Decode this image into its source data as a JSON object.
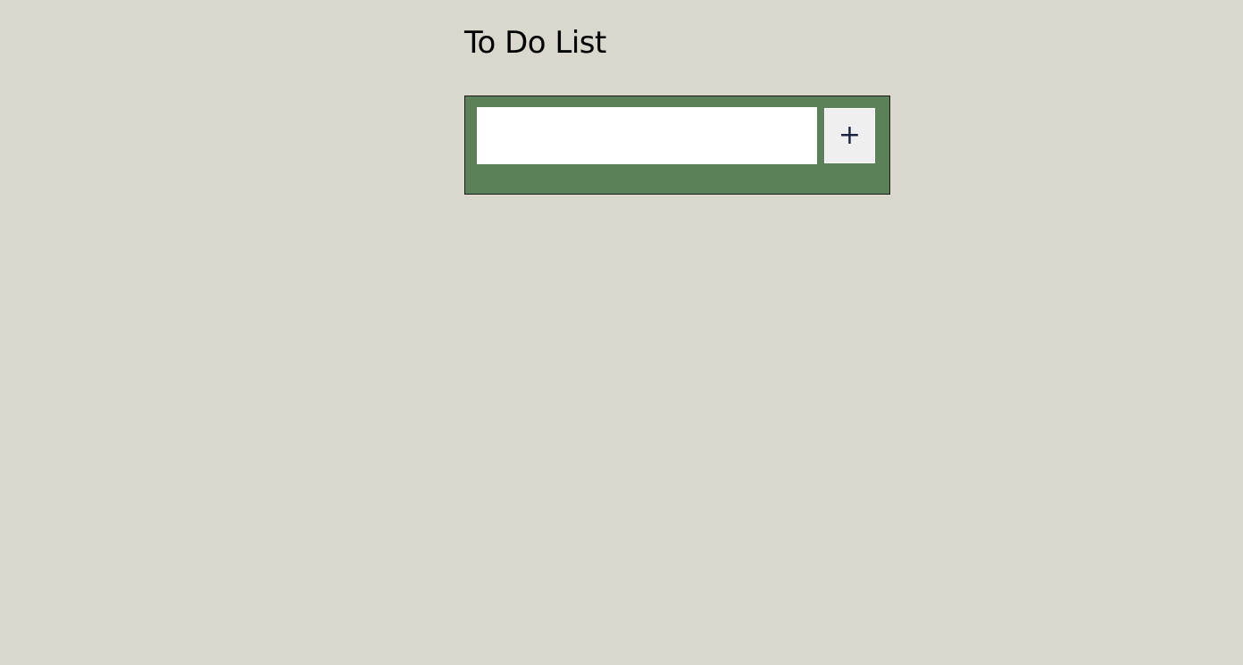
{
  "header": {
    "title": "To Do List"
  },
  "todo_form": {
    "input_value": "",
    "input_placeholder": "",
    "add_button_label": "+"
  },
  "colors": {
    "background": "#dad8cc",
    "panel": "#5a8158",
    "button_text": "#1b2340"
  }
}
